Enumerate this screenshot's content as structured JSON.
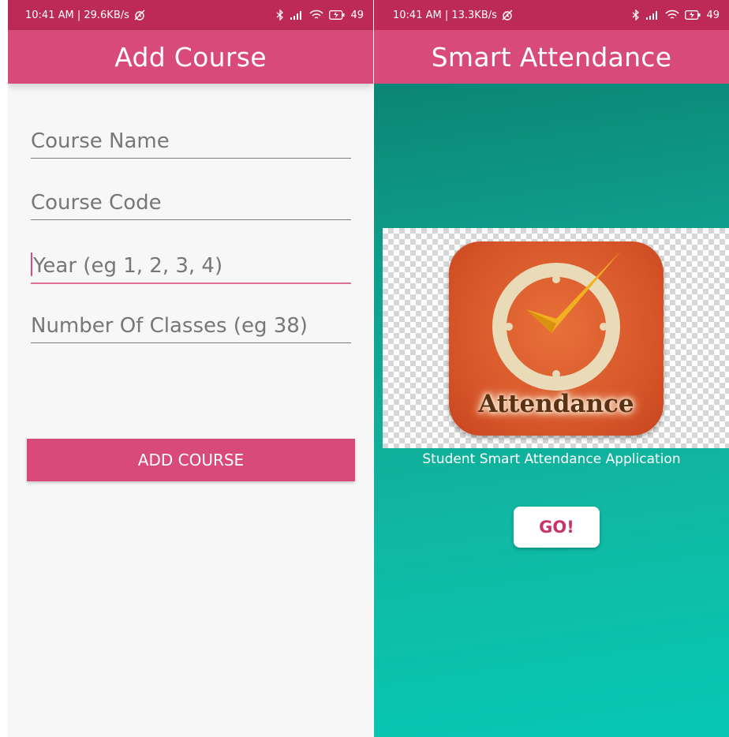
{
  "left_screen": {
    "status": {
      "time_speed": "10:41 AM | 29.6KB/s",
      "battery": "49"
    },
    "title": "Add Course",
    "fields": [
      {
        "placeholder": "Course Name",
        "focused": false
      },
      {
        "placeholder": "Course Code",
        "focused": false
      },
      {
        "placeholder": "Year (eg 1, 2, 3, 4)",
        "focused": true
      },
      {
        "placeholder": "Number Of Classes (eg 38)",
        "focused": false
      }
    ],
    "add_button": "ADD COURSE"
  },
  "right_screen": {
    "status": {
      "time_speed": "10:41 AM | 13.3KB/s",
      "battery": "49"
    },
    "title": "Smart Attendance",
    "logo_text": "Attendance",
    "tagline": "Student Smart Attendance Application",
    "go_button": "GO!"
  },
  "colors": {
    "status_bar": "#bd2a58",
    "app_bar": "#d84a79",
    "teal_background": "#10b9a3",
    "logo_orange": "#d55328"
  },
  "icons": [
    "alarm-off-icon",
    "bluetooth-icon",
    "signal-icon",
    "wifi-icon",
    "battery-charging-icon"
  ]
}
